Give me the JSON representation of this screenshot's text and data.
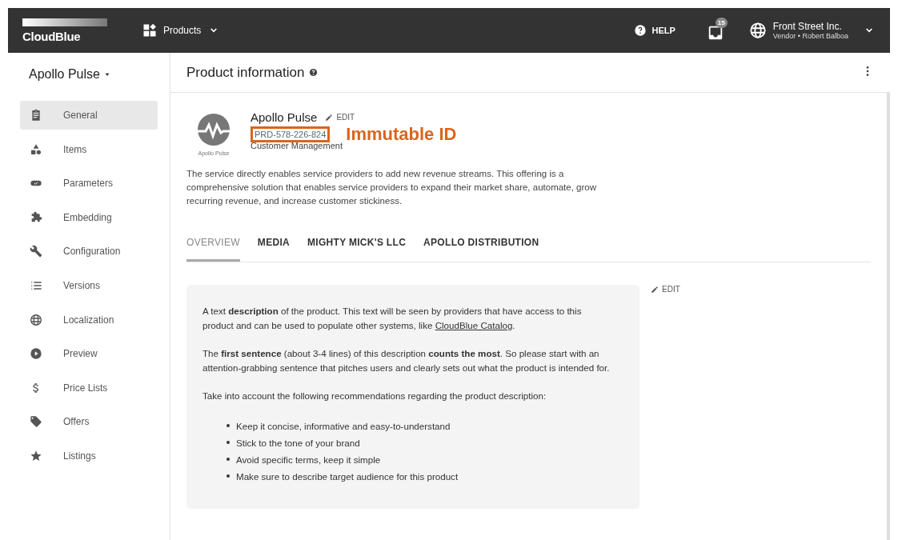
{
  "header": {
    "brand": "CloudBlue",
    "module": "Products",
    "help": "HELP",
    "notifications": "15",
    "account": {
      "name": "Front Street Inc.",
      "role": "Vendor • Robert Balboa"
    }
  },
  "sidebar": {
    "product": "Apollo Pulse",
    "items": [
      {
        "label": "General",
        "selected": true
      },
      {
        "label": "Items",
        "selected": false
      },
      {
        "label": "Parameters",
        "selected": false
      },
      {
        "label": "Embedding",
        "selected": false
      },
      {
        "label": "Configuration",
        "selected": false
      },
      {
        "label": "Versions",
        "selected": false
      },
      {
        "label": "Localization",
        "selected": false
      },
      {
        "label": "Preview",
        "selected": false
      },
      {
        "label": "Price Lists",
        "selected": false
      },
      {
        "label": "Offers",
        "selected": false
      },
      {
        "label": "Listings",
        "selected": false
      }
    ]
  },
  "page": {
    "title": "Product information",
    "product": {
      "logo_text": "Apollo Pulse",
      "name": "Apollo Pulse",
      "edit": "EDIT",
      "id": "PRD-578-226-824",
      "id_highlighted": true,
      "annotation": "Immutable ID",
      "category": "Customer Management",
      "summary": "The service directly enables service providers to add new revenue streams. This offering is a comprehensive solution that enables service providers to expand their market share, automate, grow recurring revenue, and increase customer stickiness."
    },
    "tabs": [
      {
        "label": "OVERVIEW",
        "selected": true
      },
      {
        "label": "MEDIA",
        "selected": false
      },
      {
        "label": "MIGHTY MICK'S LLC",
        "selected": false
      },
      {
        "label": "APOLLO DISTRIBUTION",
        "selected": false
      }
    ],
    "overview": {
      "edit": "EDIT",
      "intro": {
        "before": "A text **description** of the product. This text will be seen by providers that have access to this product and can be used to populate other systems, like ",
        "link": "CloudBlue Catalog",
        "after": "."
      },
      "paragraphs": [
        "The **first sentence** (about 3-4 lines) of this description **counts the most**. So please start with an attention-grabbing sentence that pitches users and clearly sets out what the product is intended for.",
        "Take into account the following recommendations regarding the product description:"
      ],
      "bullets": [
        "Keep it concise, informative and easy-to-understand",
        "Stick to the tone of your brand",
        "Avoid specific terms, keep it simple",
        "Make sure to describe target audience for this product"
      ]
    }
  }
}
